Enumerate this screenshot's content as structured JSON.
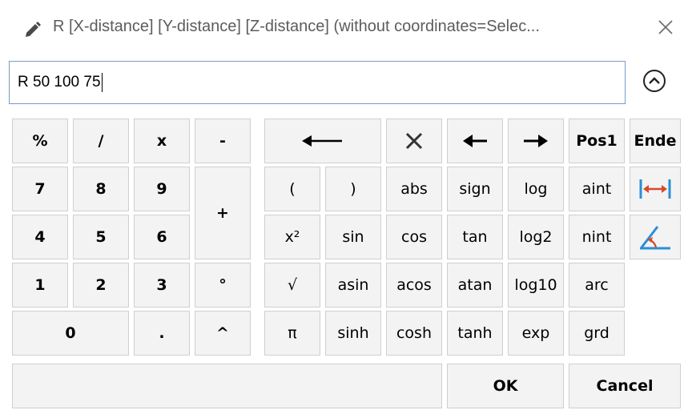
{
  "window": {
    "title": "R [X-distance] [Y-distance] [Z-distance] (without coordinates=Selec...",
    "close_icon": "close-icon",
    "edit_icon": "pencil-icon"
  },
  "input": {
    "value": "R 50 100 75"
  },
  "collapse_icon": "chevron-up-circle-icon",
  "keys": {
    "percent": "%",
    "slash": "/",
    "times": "x",
    "minus": "-",
    "seven": "7",
    "eight": "8",
    "nine": "9",
    "plus": "+",
    "four": "4",
    "five": "5",
    "six": "6",
    "one": "1",
    "two": "2",
    "three": "3",
    "degree": "°",
    "zero": "0",
    "dot": ".",
    "caret": "^",
    "backspace_icon": "backspace-arrow-icon",
    "clear_icon": "clear-x-icon",
    "left_icon": "cursor-left-icon",
    "right_icon": "cursor-right-icon",
    "pos1": "Pos1",
    "ende": "Ende",
    "lparen": "(",
    "rparen": ")",
    "abs": "abs",
    "sign": "sign",
    "log": "log",
    "aint": "aint",
    "x2": "x²",
    "sin": "sin",
    "cos": "cos",
    "tan": "tan",
    "log2": "log2",
    "nint": "nint",
    "sqrt": "√",
    "asin": "asin",
    "acos": "acos",
    "atan": "atan",
    "log10": "log10",
    "arc": "arc",
    "pi": "π",
    "sinh": "sinh",
    "cosh": "cosh",
    "tanh": "tanh",
    "exp": "exp",
    "grd": "grd",
    "measure_distance_icon": "measure-distance-icon",
    "measure_angle_icon": "measure-angle-icon",
    "ok": "OK",
    "cancel": "Cancel"
  },
  "colors": {
    "input_border": "#7a9cc6",
    "key_bg": "#f3f3f3",
    "key_border": "#cfcfcf",
    "measure_red": "#d9482b",
    "measure_blue": "#2a8fd6"
  }
}
